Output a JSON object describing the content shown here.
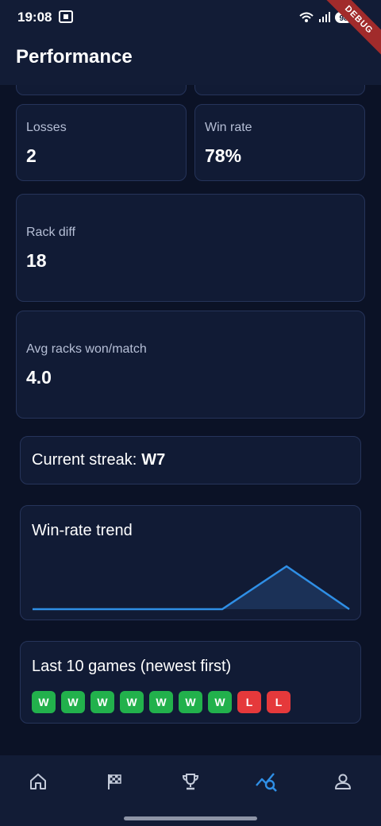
{
  "status_bar": {
    "time": "19:08",
    "debug_label": "DEBUG",
    "battery": "98"
  },
  "app_bar": {
    "title": "Performance"
  },
  "stats": {
    "losses": {
      "label": "Losses",
      "value": "2"
    },
    "win_rate": {
      "label": "Win rate",
      "value": "78%"
    },
    "rack_diff": {
      "label": "Rack diff",
      "value": "18"
    },
    "avg_racks": {
      "label": "Avg racks won/match",
      "value": "4.0"
    }
  },
  "streak": {
    "label": "Current streak:",
    "value": "W7"
  },
  "trend": {
    "title": "Win-rate trend"
  },
  "last_games": {
    "title": "Last 10 games (newest first)",
    "results": [
      "W",
      "W",
      "W",
      "W",
      "W",
      "W",
      "W",
      "L",
      "L"
    ]
  },
  "colors": {
    "accent": "#2f8fe6",
    "win": "#22b14c",
    "loss": "#e5393b",
    "background": "#0b1226",
    "card": "#111b35"
  },
  "bottom_nav": {
    "items": [
      {
        "icon": "home-icon",
        "active": false
      },
      {
        "icon": "checkered-flag-icon",
        "active": false
      },
      {
        "icon": "trophy-icon",
        "active": false
      },
      {
        "icon": "analytics-icon",
        "active": true
      },
      {
        "icon": "person-icon",
        "active": false
      }
    ]
  }
}
